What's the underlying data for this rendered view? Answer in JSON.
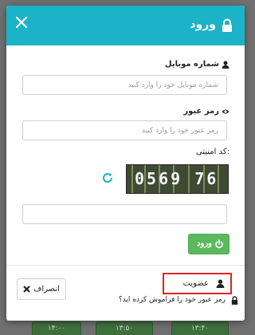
{
  "background_slots": [
    "۱۴:۰۰",
    "۱۳:۵۰",
    "۱۳:۴۰"
  ],
  "modal": {
    "title": "ورود",
    "close_symbol": "✕",
    "header_color": "#1cb2c8"
  },
  "form": {
    "mobile": {
      "label": "شماره موبایل",
      "icon": "user-icon",
      "placeholder": "شماره موبایل خود را وارد کنید",
      "value": ""
    },
    "password": {
      "label": "رمز عبور",
      "icon": "eye-icon",
      "placeholder": "رمز عبور خود را وارد کنید",
      "value": ""
    },
    "captcha": {
      "label": "کد امنیتی:",
      "image_text": "0569 76",
      "input_value": ""
    },
    "submit_label": "ورود",
    "submit_color": "#5cb85c"
  },
  "footer": {
    "cancel_label": "انصراف",
    "register_label": "عضویت",
    "forgot_label": "رمز عبور خود را فراموش کرده اید؟",
    "highlight_color": "#e02424"
  }
}
